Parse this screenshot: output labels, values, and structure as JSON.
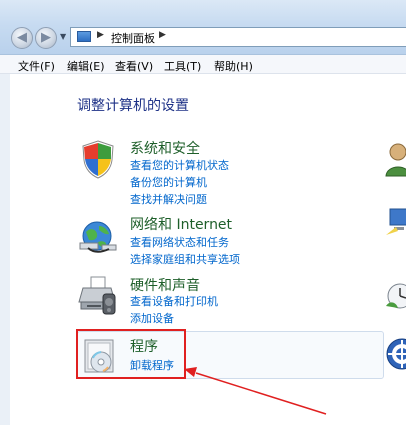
{
  "address_bar": {
    "path_label": "控制面板"
  },
  "menu": {
    "items": [
      {
        "label": "文件(F)"
      },
      {
        "label": "编辑(E)"
      },
      {
        "label": "查看(V)"
      },
      {
        "label": "工具(T)"
      },
      {
        "label": "帮助(H)"
      }
    ]
  },
  "page": {
    "title": "调整计算机的设置"
  },
  "categories": [
    {
      "title": "系统和安全",
      "icon": "shield-icon",
      "links": [
        "查看您的计算机状态",
        "备份您的计算机",
        "查找并解决问题"
      ]
    },
    {
      "title": "网络和 Internet",
      "icon": "network-globe-icon",
      "links": [
        "查看网络状态和任务",
        "选择家庭组和共享选项"
      ]
    },
    {
      "title": "硬件和声音",
      "icon": "printer-icon",
      "links": [
        "查看设备和打印机",
        "添加设备"
      ]
    },
    {
      "title": "程序",
      "icon": "programs-icon",
      "links": [
        "卸载程序"
      ]
    }
  ],
  "colors": {
    "category_title": "#1e5f2a",
    "link": "#0066cc",
    "page_title": "#1e3287",
    "annotation": "#e02020"
  }
}
